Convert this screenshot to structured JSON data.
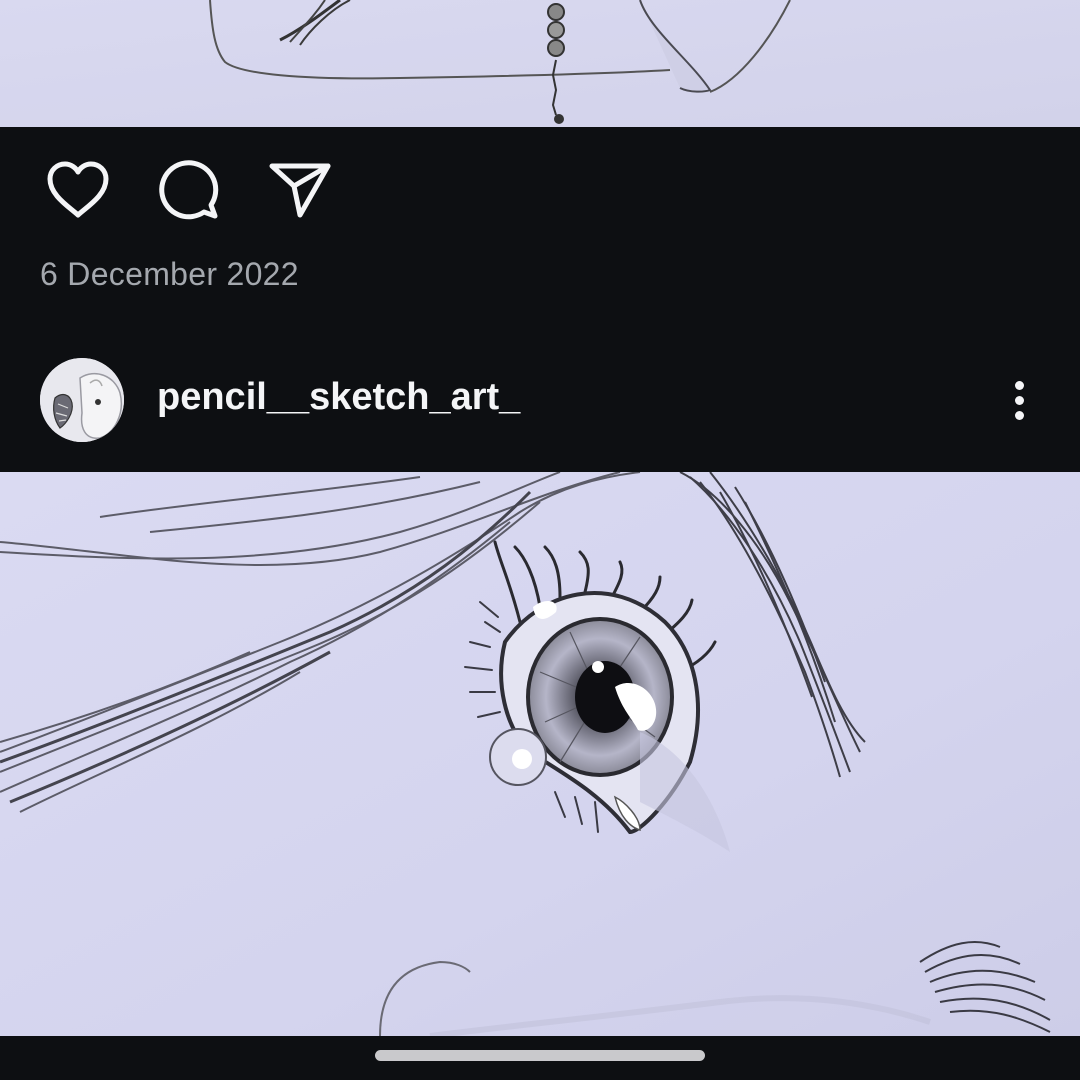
{
  "post": {
    "date": "6 December 2022",
    "actions": {
      "like_icon": "heart-outline-icon",
      "comment_icon": "speech-bubble-icon",
      "share_icon": "paper-plane-icon"
    }
  },
  "next_post": {
    "username": "pencil__sketch_art_",
    "avatar_icon": "profile-avatar",
    "menu_icon": "more-vertical-icon"
  },
  "theme": {
    "background": "#0d0f12",
    "text_primary": "#f4f5f7",
    "text_secondary": "#a4a8ae",
    "sketch_paper": "#d6d6ee"
  }
}
